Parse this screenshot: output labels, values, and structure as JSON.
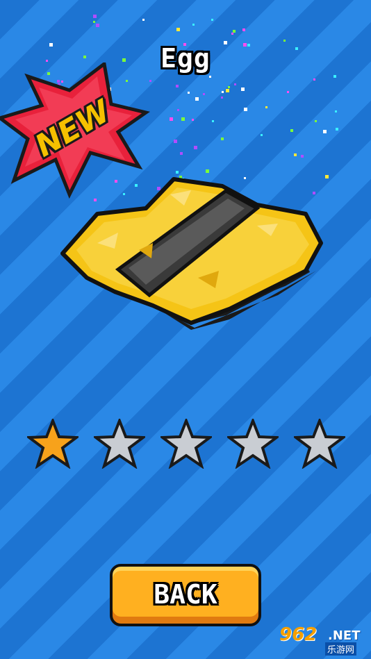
{
  "item": {
    "name": "Egg",
    "new_badge": "NEW",
    "illustration_icon": "egg-sushi-icon"
  },
  "rating": {
    "value": 1,
    "max": 5
  },
  "back_button": {
    "label": "BACK"
  },
  "watermark": {
    "brand": "962",
    "domain": ".NET",
    "sub": "乐游网"
  },
  "colors": {
    "background": "#1f7ad8",
    "star_filled": "#f7a21b",
    "star_empty": "#c9cdd3",
    "button": "#ffb020",
    "badge": "#e8213b"
  }
}
